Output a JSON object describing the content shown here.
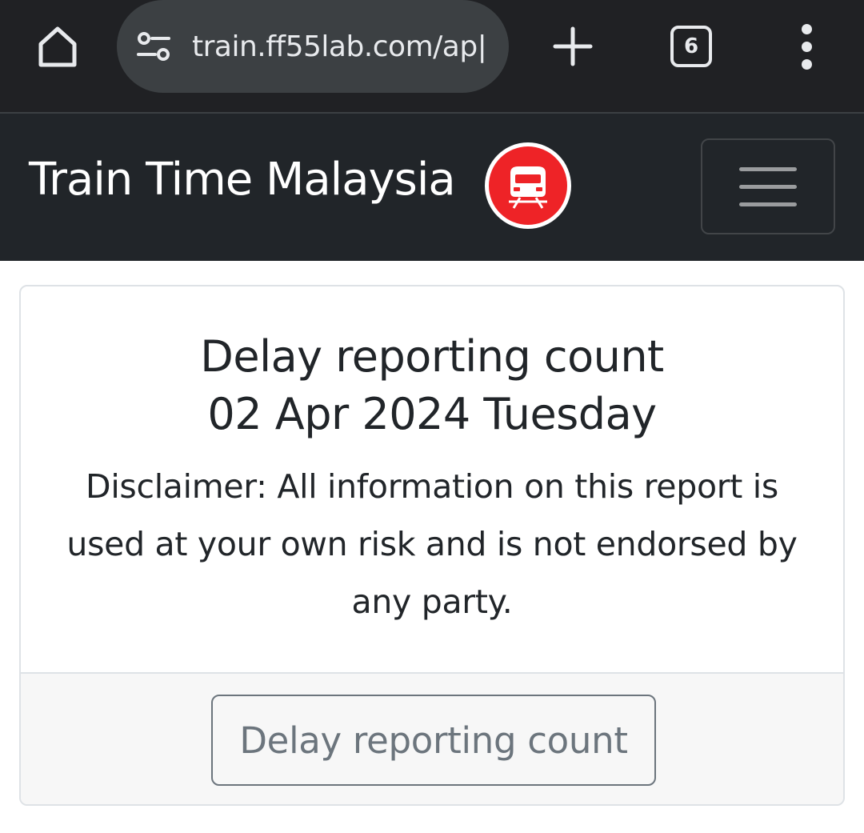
{
  "browser": {
    "url": "train.ff55lab.com/ap|",
    "tab_count": "6",
    "icons": {
      "home": "home-icon",
      "site_settings": "site-settings-icon",
      "new_tab": "plus-icon",
      "menu": "more-vertical-icon"
    }
  },
  "navbar": {
    "brand": "Train Time Malaysia",
    "logo_icon": "train-icon",
    "toggler_icon": "hamburger-icon"
  },
  "card": {
    "title_line1": "Delay reporting count",
    "title_line2": "02 Apr 2024 Tuesday",
    "disclaimer": "Disclaimer: All information on this report is used at your own risk and is not endorsed by any party.",
    "button_label": "Delay reporting count"
  },
  "colors": {
    "browser_bg": "#202124",
    "navbar_bg": "#212529",
    "logo_red": "#ee2327",
    "button_outline": "#6c757d",
    "footer_bg": "#f7f7f7"
  }
}
